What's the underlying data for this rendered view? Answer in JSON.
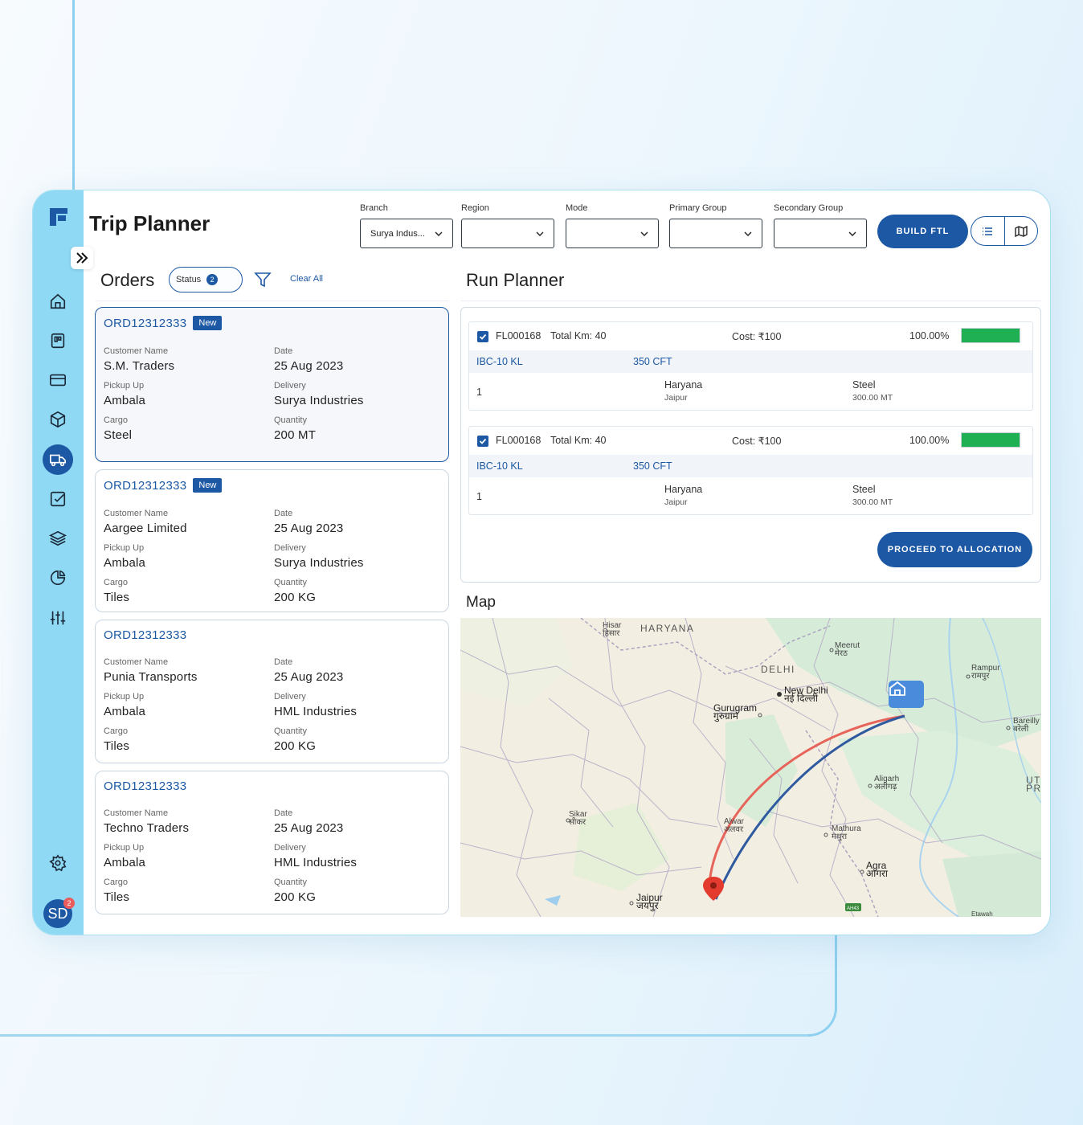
{
  "app": {
    "title": "Trip Planner"
  },
  "icons": {
    "logo": "logo-icon",
    "expand": "double-chevron-right-icon",
    "rail": [
      "home-icon",
      "board-icon",
      "card-icon",
      "package-icon",
      "truck-icon",
      "checklist-icon",
      "layers-icon",
      "pie-chart-icon",
      "sliders-icon",
      "settings-icon"
    ]
  },
  "colors": {
    "primary": "#1c58a4",
    "rail": "#8fd9f4",
    "success": "#1eb052",
    "route_red": "#e7645a",
    "route_blue": "#2f5aa0"
  },
  "user": {
    "initials": "SD",
    "notifications": "2"
  },
  "filters": {
    "branch": {
      "label": "Branch",
      "value": "Surya Indus..."
    },
    "region": {
      "label": "Region",
      "value": ""
    },
    "mode": {
      "label": "Mode",
      "value": ""
    },
    "primary_group": {
      "label": "Primary Group",
      "value": ""
    },
    "secondary_group": {
      "label": "Secondary Group",
      "value": ""
    }
  },
  "toolbar": {
    "build_label": "BUILD FTL"
  },
  "orders": {
    "title": "Orders",
    "status_label": "Status",
    "status_count": "2",
    "clear_label": "Clear All",
    "items": [
      {
        "id": "ORD12312333",
        "badge": "New",
        "customer_label": "Customer Name",
        "customer": "S.M. Traders",
        "date_label": "Date",
        "date": "25 Aug 2023",
        "pickup_label": "Pickup Up",
        "pickup": "Ambala",
        "delivery_label": "Delivery",
        "delivery": "Surya Industries",
        "cargo_label": "Cargo",
        "cargo": "Steel",
        "quantity_label": "Quantity",
        "quantity": "200 MT"
      },
      {
        "id": "ORD12312333",
        "badge": "New",
        "customer_label": "Customer Name",
        "customer": "Aargee Limited",
        "date_label": "Date",
        "date": "25 Aug 2023",
        "pickup_label": "Pickup Up",
        "pickup": "Ambala",
        "delivery_label": "Delivery",
        "delivery": "Surya Industries",
        "cargo_label": "Cargo",
        "cargo": "Tiles",
        "quantity_label": "Quantity",
        "quantity": "200 KG"
      },
      {
        "id": "ORD12312333",
        "badge": "",
        "customer_label": "Customer Name",
        "customer": "Punia Transports",
        "date_label": "Date",
        "date": "25 Aug 2023",
        "pickup_label": "Pickup Up",
        "pickup": "Ambala",
        "delivery_label": "Delivery",
        "delivery": "HML Industries",
        "cargo_label": "Cargo",
        "cargo": "Tiles",
        "quantity_label": "Quantity",
        "quantity": "200 KG"
      },
      {
        "id": "ORD12312333",
        "badge": "",
        "customer_label": "Customer Name",
        "customer": "Techno Traders",
        "date_label": "Date",
        "date": "25 Aug 2023",
        "pickup_label": "Pickup Up",
        "pickup": "Ambala",
        "delivery_label": "Delivery",
        "delivery": "HML Industries",
        "cargo_label": "Cargo",
        "cargo": "Tiles",
        "quantity_label": "Quantity",
        "quantity": "200 KG"
      }
    ]
  },
  "run_planner": {
    "title": "Run Planner",
    "runs": [
      {
        "id": "FL000168",
        "km": "Total Km: 40",
        "cost": "Cost: ₹100",
        "percent": "100.00%",
        "fill": 1.0,
        "vehicle": "IBC-10 KL",
        "capacity": "350 CFT",
        "seq": "1",
        "state": "Haryana",
        "city": "Jaipur",
        "material": "Steel",
        "weight": "300.00 MT"
      },
      {
        "id": "FL000168",
        "km": "Total Km: 40",
        "cost": "Cost: ₹100",
        "percent": "100.00%",
        "fill": 1.0,
        "vehicle": "IBC-10 KL",
        "capacity": "350 CFT",
        "seq": "1",
        "state": "Haryana",
        "city": "Jaipur",
        "material": "Steel",
        "weight": "300.00 MT"
      }
    ],
    "proceed_label": "PROCEED TO ALLOCATION"
  },
  "map": {
    "title": "Map",
    "labels": {
      "haryana": "HARYANA",
      "hisar": "Hisar",
      "hisar_hi": "हिसार",
      "meerut": "Meerut",
      "meerut_hi": "मेरठ",
      "delhi": "DELHI",
      "new_delhi": "New Delhi",
      "new_delhi_hi": "नई दिल्ली",
      "gurugram": "Gurugram",
      "gurugram_hi": "गुरुग्राम",
      "rampur": "Rampur",
      "rampur_hi": "रामपुर",
      "bareilly": "Bareilly",
      "bareilly_hi": "बरेली",
      "aligarh": "Aligarh",
      "aligarh_hi": "अलीगढ़",
      "ut": "UT",
      "pra": "PRA",
      "sikar": "Sikar",
      "sikar_hi": "सीकर",
      "alwar": "Alwar",
      "alwar_hi": "अलवर",
      "mathura": "Mathura",
      "mathura_hi": "मथुरा",
      "agra": "Agra",
      "agra_hi": "आगरा",
      "jaipur": "Jaipur",
      "jaipur_hi": "जयपुर",
      "etawah": "Etawah",
      "ah43": "AH43"
    },
    "pin_icons": [
      "home-pin-icon",
      "location-pin-icon"
    ]
  }
}
